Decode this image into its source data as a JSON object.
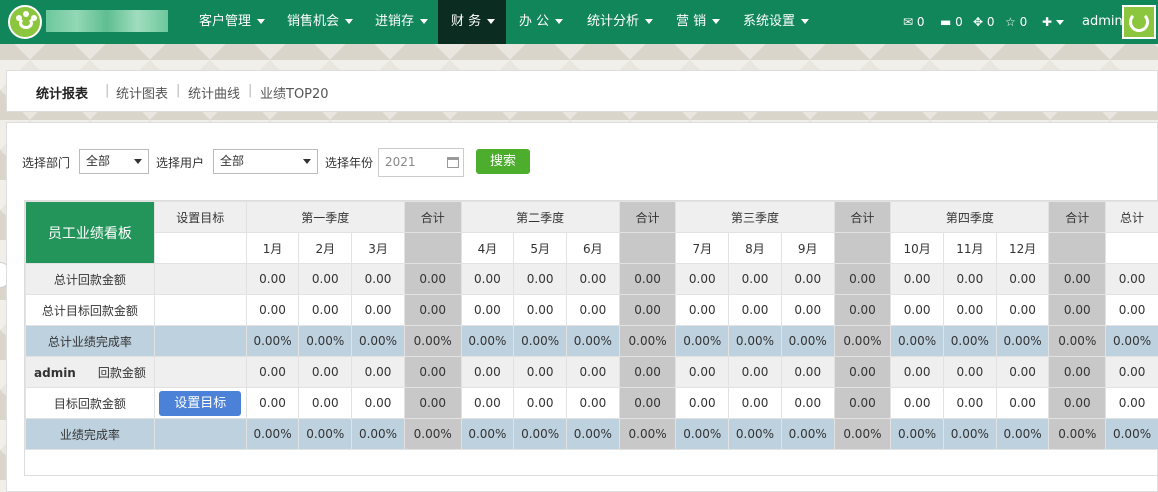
{
  "nav": {
    "items": [
      {
        "label": "客户管理",
        "dropdown": true
      },
      {
        "label": "销售机会",
        "dropdown": true
      },
      {
        "label": "进销存",
        "dropdown": true
      },
      {
        "label": "财 务",
        "dropdown": true,
        "active": true
      },
      {
        "label": "办 公",
        "dropdown": true
      },
      {
        "label": "统计分析",
        "dropdown": true
      },
      {
        "label": "营 销",
        "dropdown": true
      },
      {
        "label": "系统设置",
        "dropdown": true
      }
    ],
    "badges": {
      "mail": "0",
      "card": "0",
      "gear": "0",
      "star": "0"
    },
    "plus": "✚",
    "user": "admin"
  },
  "tabs": [
    {
      "label": "统计报表"
    },
    {
      "label": "统计图表"
    },
    {
      "label": "统计曲线"
    },
    {
      "label": "业绩TOP20"
    }
  ],
  "filters": {
    "dept_label": "选择部门",
    "dept_value": "全部",
    "user_label": "选择用户",
    "user_value": "全部",
    "year_label": "选择年份",
    "year_value": "2021",
    "search_label": "搜索"
  },
  "table": {
    "corner": "员工业绩看板",
    "target_header": "设置目标",
    "quarters": [
      "第一季度",
      "第二季度",
      "第三季度",
      "第四季度"
    ],
    "sum_label": "合计",
    "total_label": "总计",
    "months": [
      "1月",
      "2月",
      "3月",
      "4月",
      "5月",
      "6月",
      "7月",
      "8月",
      "9月",
      "10月",
      "11月",
      "12月"
    ],
    "rows": [
      {
        "label": "总计回款金额",
        "type": "amount",
        "cells": [
          "0.00",
          "0.00",
          "0.00",
          "0.00",
          "0.00",
          "0.00",
          "0.00",
          "0.00",
          "0.00",
          "0.00",
          "0.00",
          "0.00",
          "0.00",
          "0.00",
          "0.00",
          "0.00",
          "0.00"
        ]
      },
      {
        "label": "总计目标回款金额",
        "type": "amount",
        "cells": [
          "0.00",
          "0.00",
          "0.00",
          "0.00",
          "0.00",
          "0.00",
          "0.00",
          "0.00",
          "0.00",
          "0.00",
          "0.00",
          "0.00",
          "0.00",
          "0.00",
          "0.00",
          "0.00",
          "0.00"
        ]
      },
      {
        "label": "总计业绩完成率",
        "type": "rate",
        "cells": [
          "0.00%",
          "0.00%",
          "0.00%",
          "0.00%",
          "0.00%",
          "0.00%",
          "0.00%",
          "0.00%",
          "0.00%",
          "0.00%",
          "0.00%",
          "0.00%",
          "0.00%",
          "0.00%",
          "0.00%",
          "0.00%",
          "0.00%"
        ]
      },
      {
        "user": "admin",
        "label": "回款金额",
        "type": "amount",
        "cells": [
          "0.00",
          "0.00",
          "0.00",
          "0.00",
          "0.00",
          "0.00",
          "0.00",
          "0.00",
          "0.00",
          "0.00",
          "0.00",
          "0.00",
          "0.00",
          "0.00",
          "0.00",
          "0.00",
          "0.00"
        ]
      },
      {
        "label": "目标回款金额",
        "type": "amount",
        "button": "设置目标",
        "cells": [
          "0.00",
          "0.00",
          "0.00",
          "0.00",
          "0.00",
          "0.00",
          "0.00",
          "0.00",
          "0.00",
          "0.00",
          "0.00",
          "0.00",
          "0.00",
          "0.00",
          "0.00",
          "0.00",
          "0.00"
        ]
      },
      {
        "label": "业绩完成率",
        "type": "rate",
        "cells": [
          "0.00%",
          "0.00%",
          "0.00%",
          "0.00%",
          "0.00%",
          "0.00%",
          "0.00%",
          "0.00%",
          "0.00%",
          "0.00%",
          "0.00%",
          "0.00%",
          "0.00%",
          "0.00%",
          "0.00%",
          "0.00%",
          "0.00%"
        ]
      }
    ]
  },
  "colors": {
    "brand": "#12865b",
    "active_nav": "#0b2c20",
    "search_btn": "#4cae2c",
    "target_btn": "#4b81d7",
    "rate_row": "#bed1df",
    "sum_col": "#c8c8c8"
  }
}
